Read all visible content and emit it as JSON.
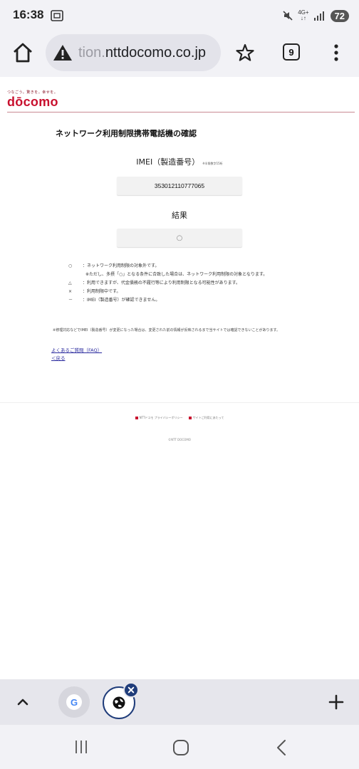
{
  "status": {
    "time": "16:38",
    "net_top": "4G+",
    "net_bottom": "↓↑",
    "battery": "72"
  },
  "toolbar": {
    "url_faded": "tion.",
    "url_main": "nttdocomo.co.jp",
    "tab_count": "9"
  },
  "page": {
    "tagline": "つなごう。驚きを。幸せを。",
    "logo": "dōcomo",
    "title": "ネットワーク利用制限携帯電話機の確認",
    "imei_label": "IMEI（製造番号）",
    "imei_note": "※半角数字15桁",
    "imei_value": "353012110777065",
    "result_label": "結果",
    "result_value": "○",
    "legend": [
      {
        "symbol": "○",
        "text": "：ネットワーク利用制限の対象外です。"
      },
      {
        "symbol": "",
        "text": "※ただし、多摂「○」となる条件に合致した場合は、ネットワーク利用制限の対象となります。"
      },
      {
        "symbol": "△",
        "text": "：利用できますが、代金債務の不履行等により利用制限となる可能性があります。"
      },
      {
        "symbol": "×",
        "text": "：利用制限中です。"
      },
      {
        "symbol": "－",
        "text": "：IMEI（製造番号）が確認できません。"
      }
    ],
    "footnote": "※修理対応などでIMEI（製造番号）が変更になった場合は、変更された前の情報が反映されるまで当サイトでは確認できないことがあります。",
    "link_faq": "よくあるご質問（FAQ）",
    "link_back": "＜戻る",
    "footer_links": [
      "NTTドコモ プライバシーポリシー",
      "サイトご利用にあたって"
    ],
    "copyright": "©NTT DOCOMO"
  },
  "tabstrip": {
    "g_label": "G"
  },
  "colors": {
    "brand": "#c8102e",
    "link": "#2a2a9e",
    "active_tab": "#1f3c7a"
  }
}
